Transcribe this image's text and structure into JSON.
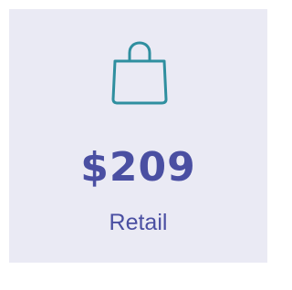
{
  "card": {
    "icon": "shopping-bag-icon",
    "price": "$209",
    "label": "Retail"
  },
  "colors": {
    "background": "#eaeaf4",
    "icon": "#2f8f9f",
    "text": "#4a4fa2"
  }
}
